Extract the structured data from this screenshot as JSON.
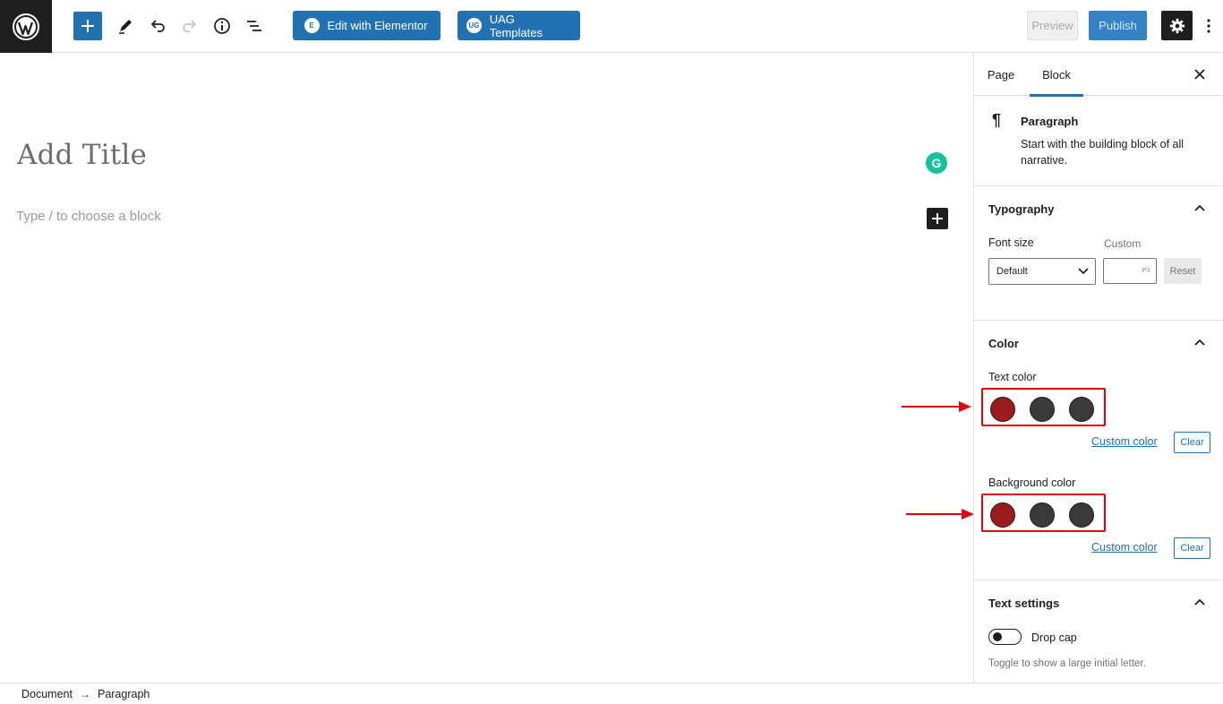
{
  "toolbar": {
    "elementor_label": "Edit with Elementor",
    "elementor_badge": "E",
    "uag_label": "UAG Templates",
    "uag_badge": "UG",
    "preview_label": "Preview",
    "publish_label": "Publish"
  },
  "editor": {
    "title_placeholder": "Add Title",
    "block_placeholder": "Type / to choose a block",
    "grammarly_letter": "G"
  },
  "sidebar": {
    "tabs": [
      {
        "label": "Page",
        "active": false
      },
      {
        "label": "Block",
        "active": true
      }
    ],
    "block": {
      "icon": "¶",
      "title": "Paragraph",
      "description": "Start with the building block of all narrative."
    },
    "typography": {
      "title": "Typography",
      "font_size_label": "Font size",
      "custom_label": "Custom",
      "select_value": "Default",
      "unit": "PX",
      "reset_label": "Reset"
    },
    "color": {
      "title": "Color",
      "text_color_label": "Text color",
      "background_color_label": "Background color",
      "swatches": [
        "#9b1c1c",
        "#3a3a3a",
        "#3a3a3a"
      ],
      "custom_color_label": "Custom color",
      "clear_label": "Clear"
    },
    "text_settings": {
      "title": "Text settings",
      "drop_cap_label": "Drop cap",
      "help_text": "Toggle to show a large initial letter."
    }
  },
  "breadcrumb": {
    "items": [
      "Document",
      "Paragraph"
    ],
    "separator": "→"
  },
  "colors": {
    "accent": "#2271b1",
    "annotation_red": "#e1000f",
    "dark": "#1e1e1e"
  }
}
